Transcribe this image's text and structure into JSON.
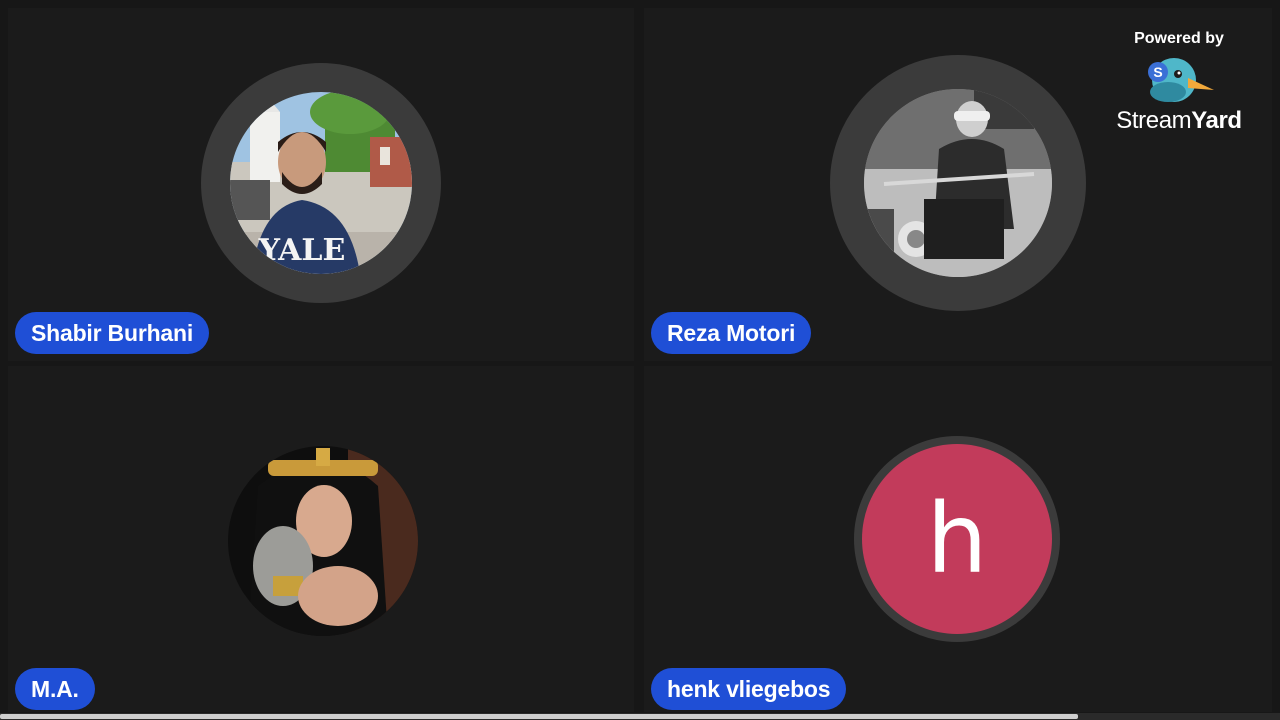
{
  "branding": {
    "powered_by": "Powered by",
    "brand_part1": "Stream",
    "brand_part2": "Yard",
    "logo_icon": "duck-logo-icon"
  },
  "participants": [
    {
      "name": "Shabir Burhani",
      "avatar": "photo",
      "shirt_text": "YALE"
    },
    {
      "name": "Reza Motori",
      "avatar": "photo"
    },
    {
      "name": "M.A.",
      "avatar": "photo"
    },
    {
      "name": "henk vliegebos",
      "avatar": "letter",
      "initial": "h",
      "avatar_color": "#c23b5b"
    }
  ],
  "colors": {
    "name_tag_bg": "#1f4fd6",
    "tile_bg": "#1b1b1b",
    "ring": "#3b3b3b"
  }
}
